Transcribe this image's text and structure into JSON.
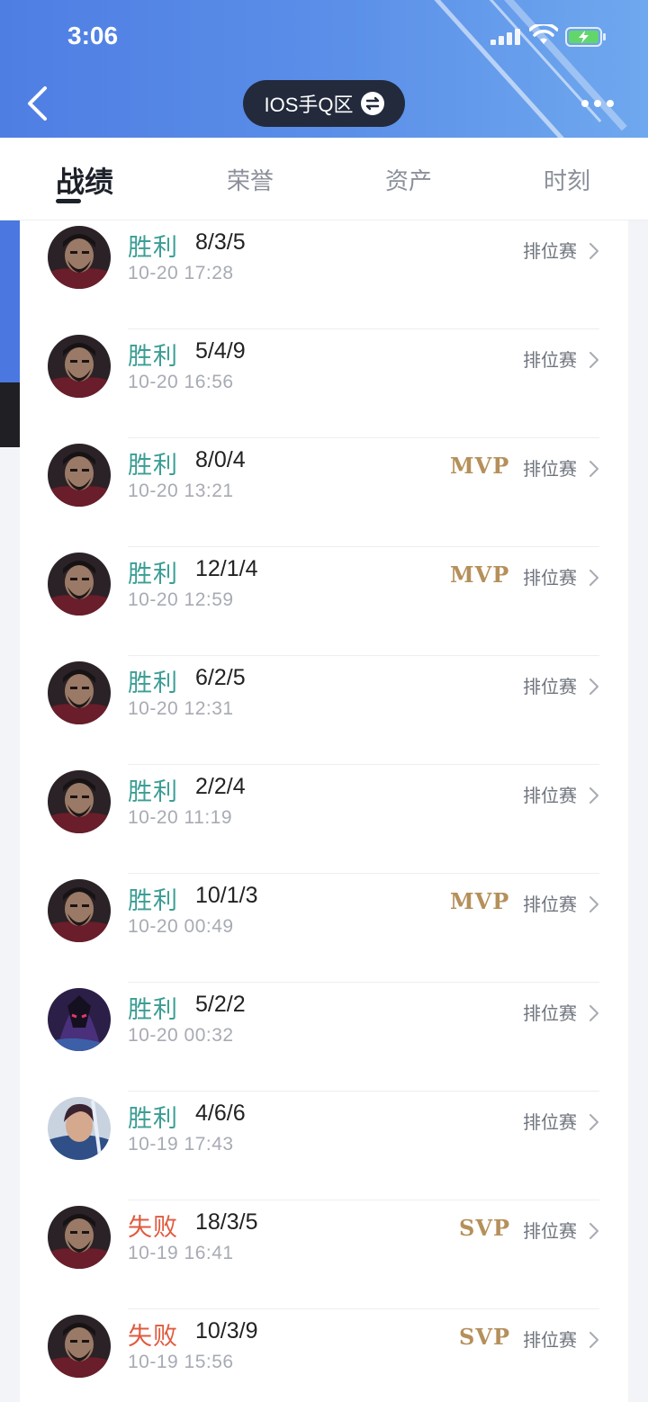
{
  "status_bar": {
    "time": "3:06"
  },
  "header": {
    "server_label": "IOS手Q区"
  },
  "tabs": [
    {
      "label": "战绩",
      "active": true
    },
    {
      "label": "荣誉",
      "active": false
    },
    {
      "label": "资产",
      "active": false
    },
    {
      "label": "时刻",
      "active": false
    }
  ],
  "matches": [
    {
      "result": "胜利",
      "outcome": "win",
      "kda": "8/3/5",
      "time": "10-20 17:28",
      "badge": "",
      "mode": "排位赛",
      "hero": "dark-warrior"
    },
    {
      "result": "胜利",
      "outcome": "win",
      "kda": "5/4/9",
      "time": "10-20 16:56",
      "badge": "",
      "mode": "排位赛",
      "hero": "dark-warrior"
    },
    {
      "result": "胜利",
      "outcome": "win",
      "kda": "8/0/4",
      "time": "10-20 13:21",
      "badge": "MVP",
      "mode": "排位赛",
      "hero": "dark-warrior"
    },
    {
      "result": "胜利",
      "outcome": "win",
      "kda": "12/1/4",
      "time": "10-20 12:59",
      "badge": "MVP",
      "mode": "排位赛",
      "hero": "dark-warrior"
    },
    {
      "result": "胜利",
      "outcome": "win",
      "kda": "6/2/5",
      "time": "10-20 12:31",
      "badge": "",
      "mode": "排位赛",
      "hero": "dark-warrior"
    },
    {
      "result": "胜利",
      "outcome": "win",
      "kda": "2/2/4",
      "time": "10-20 11:19",
      "badge": "",
      "mode": "排位赛",
      "hero": "dark-warrior"
    },
    {
      "result": "胜利",
      "outcome": "win",
      "kda": "10/1/3",
      "time": "10-20 00:49",
      "badge": "MVP",
      "mode": "排位赛",
      "hero": "dark-warrior"
    },
    {
      "result": "胜利",
      "outcome": "win",
      "kda": "5/2/2",
      "time": "10-20 00:32",
      "badge": "",
      "mode": "排位赛",
      "hero": "purple-assassin"
    },
    {
      "result": "胜利",
      "outcome": "win",
      "kda": "4/6/6",
      "time": "10-19 17:43",
      "badge": "",
      "mode": "排位赛",
      "hero": "blue-swordsman"
    },
    {
      "result": "失败",
      "outcome": "lose",
      "kda": "18/3/5",
      "time": "10-19 16:41",
      "badge": "SVP",
      "mode": "排位赛",
      "hero": "dark-warrior"
    },
    {
      "result": "失败",
      "outcome": "lose",
      "kda": "10/3/9",
      "time": "10-19 15:56",
      "badge": "SVP",
      "mode": "排位赛",
      "hero": "dark-warrior"
    }
  ],
  "colors": {
    "win": "#3b9e95",
    "lose": "#e05a3f",
    "badge_gold": "#b5905b",
    "header_blue": "#4f7ee3"
  },
  "icons": {
    "back": "chevron-left-icon",
    "swap": "swap-arrows-icon",
    "more": "more-dots-icon",
    "row_arrow": "chevron-right-icon"
  }
}
